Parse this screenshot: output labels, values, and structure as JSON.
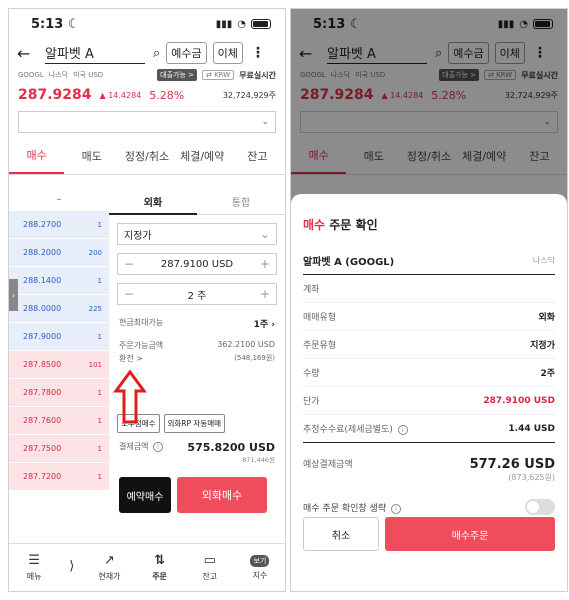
{
  "status": {
    "time": "5:13",
    "moon": "☾"
  },
  "header": {
    "title": "알파벳 A",
    "deposit_btn": "예수금",
    "transfer_btn": "이체"
  },
  "subinfo": {
    "ticker": "GOOGL",
    "market": "나스닥",
    "currency": "미국 USD",
    "loan_tag": "대출가능 >",
    "krw_tag": "⇄ KRW",
    "realtime": "무료실시간"
  },
  "price": {
    "current": "287.9284",
    "change": "▲ 14.4284",
    "pct": "5.28%",
    "volume": "32,724,929주"
  },
  "tabs": [
    "매수",
    "매도",
    "정정/취소",
    "체결/예약",
    "잔고"
  ],
  "orderbook": {
    "top": "–",
    "sell": [
      {
        "p": "288.2700",
        "q": "1"
      },
      {
        "p": "288.2000",
        "q": "200"
      },
      {
        "p": "288.1400",
        "q": "1"
      },
      {
        "p": "288.0000",
        "q": "225"
      },
      {
        "p": "287.9000",
        "q": "1"
      }
    ],
    "buy": [
      {
        "p": "287.8500",
        "q": "101"
      },
      {
        "p": "287.7800",
        "q": "1"
      },
      {
        "p": "287.7600",
        "q": "1"
      },
      {
        "p": "287.7500",
        "q": "1"
      },
      {
        "p": "287.7200",
        "q": "1"
      }
    ]
  },
  "form": {
    "tab_foreign": "외화",
    "tab_integrated": "통합",
    "order_type": "지정가",
    "price": "287.9100 USD",
    "qty": "2 주",
    "max_cash_label": "현금최대가능",
    "max_cash_value": "1주",
    "orderable_label": "주문가능금액",
    "orderable_usd": "362.2100 USD",
    "exchange": "환전 >",
    "orderable_krw": "(548,169원)",
    "btn_fraction": "소수점매수",
    "btn_rp": "외화RP 자동매매",
    "total_label": "결제금액",
    "total_usd": "575.8200 USD",
    "total_krw": "871,446원",
    "reserve_btn": "예약매수",
    "buy_btn": "외화매수"
  },
  "nav": [
    {
      "icon": "☰",
      "label": "메뉴"
    },
    {
      "icon": "⟩",
      "label": ""
    },
    {
      "icon": "↗",
      "label": "현재가"
    },
    {
      "icon": "⇅",
      "label": "주문"
    },
    {
      "icon": "▭",
      "label": "잔고"
    },
    {
      "icon": "보기",
      "label": "지수"
    }
  ],
  "dialog": {
    "title_red": "매수",
    "title_rest": " 주문 확인",
    "stock": "알파벳 A (GOOGL)",
    "market": "나스닥",
    "account_label": "계좌",
    "trade_type_label": "매매유형",
    "trade_type": "외화",
    "order_type_label": "주문유형",
    "order_type": "지정가",
    "qty_label": "수량",
    "qty": "2주",
    "price_label": "단가",
    "price": "287.9100 USD",
    "fee_label": "추정수수료(제세금별도)",
    "fee": "1.44 USD",
    "est_label": "예상결제금액",
    "est_usd": "577.26 USD",
    "est_krw": "(873,625원)",
    "skip_label": "매수 주문 확인창 생략",
    "cancel": "취소",
    "confirm": "매수주문"
  },
  "colors": {
    "accent": "#ef4c5c",
    "up": "#e0304a",
    "ask": "#2d5fc4"
  }
}
